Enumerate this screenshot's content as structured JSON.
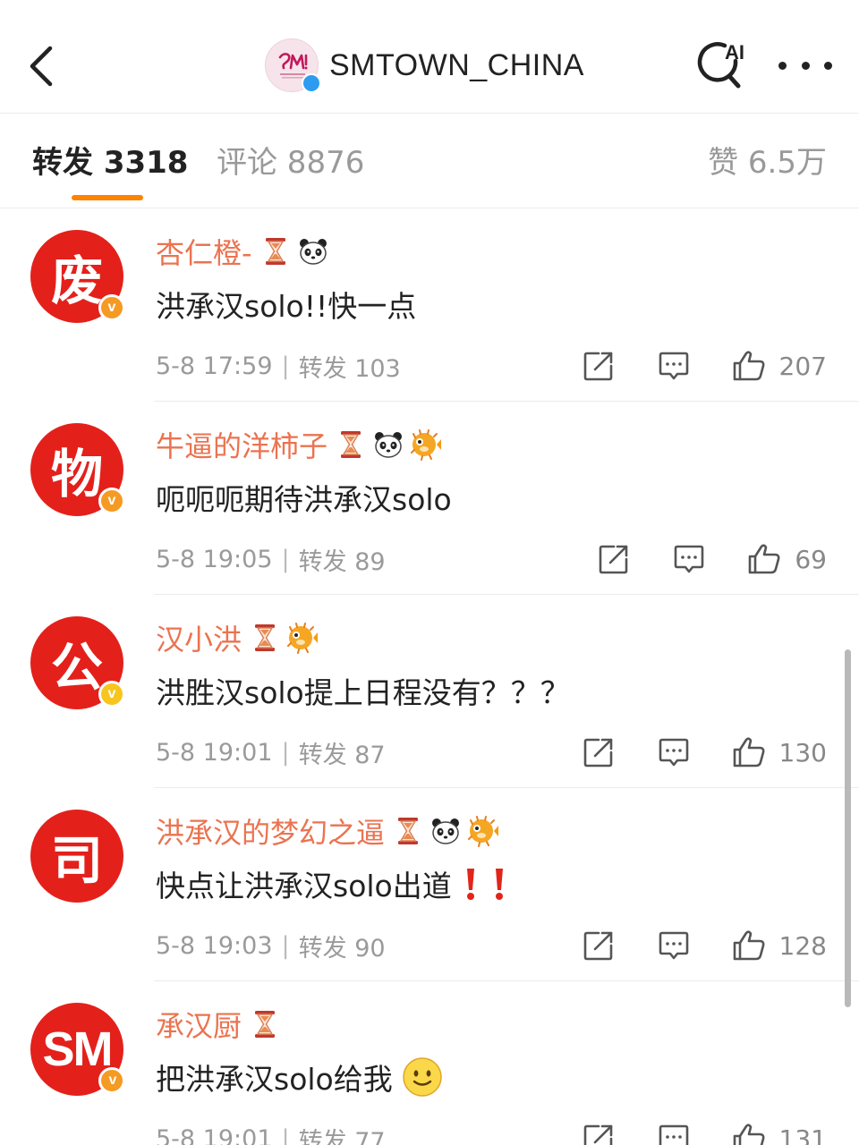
{
  "header": {
    "account_name": "SMTOWN_CHINA",
    "ai_label": "AI"
  },
  "tabs": {
    "repost_label": "转发 3318",
    "comment_label": "评论 8876",
    "like_label": "赞 6.5万"
  },
  "comments": [
    {
      "avatar_text": "废",
      "badge_letter": "v",
      "username": "杏仁橙-",
      "badges": [
        "hourglass-icon",
        "panda-icon"
      ],
      "text": "洪承汉solo!!快一点",
      "time": "5-8 17:59",
      "repost": "转发 103",
      "likes": "207"
    },
    {
      "avatar_text": "物",
      "badge_letter": "v",
      "username": "牛逼的洋柿子",
      "badges": [
        "hourglass-icon",
        "panda-icon",
        "pufferfish-icon"
      ],
      "text": "呃呃呃期待洪承汉solo",
      "time": "5-8 19:05",
      "repost": "转发 89",
      "likes": "69"
    },
    {
      "avatar_text": "公",
      "badge_letter": "v",
      "username": "汉小洪",
      "badges": [
        "hourglass-icon",
        "pufferfish-icon"
      ],
      "text": "洪胜汉solo提上日程没有？？？",
      "time": "5-8 19:01",
      "repost": "转发 87",
      "likes": "130"
    },
    {
      "avatar_text": "司",
      "badge_letter": "",
      "username": "洪承汉的梦幻之逼",
      "badges": [
        "hourglass-icon",
        "panda-icon",
        "pufferfish-icon"
      ],
      "text": "快点让洪承汉solo出道",
      "text_emoji": [
        "exclamation-icon",
        "exclamation-icon"
      ],
      "time": "5-8 19:03",
      "repost": "转发 90",
      "likes": "128"
    },
    {
      "avatar_text": "SM",
      "badge_letter": "v",
      "username": "承汉厨",
      "badges": [
        "hourglass-icon"
      ],
      "text": "把洪承汉solo给我",
      "text_emoji": [
        "smiley-icon"
      ],
      "time": "5-8 19:01",
      "repost": "转发 77",
      "likes": "131"
    }
  ],
  "colors": {
    "accent": "#ff8200",
    "username": "#eb7350",
    "avatar_red": "#e4201b",
    "badge_orange": "#f59a23",
    "badge_yellow": "#f7c51e",
    "verified_blue": "#2d9cf0",
    "meta_gray": "#9a9a9a"
  }
}
